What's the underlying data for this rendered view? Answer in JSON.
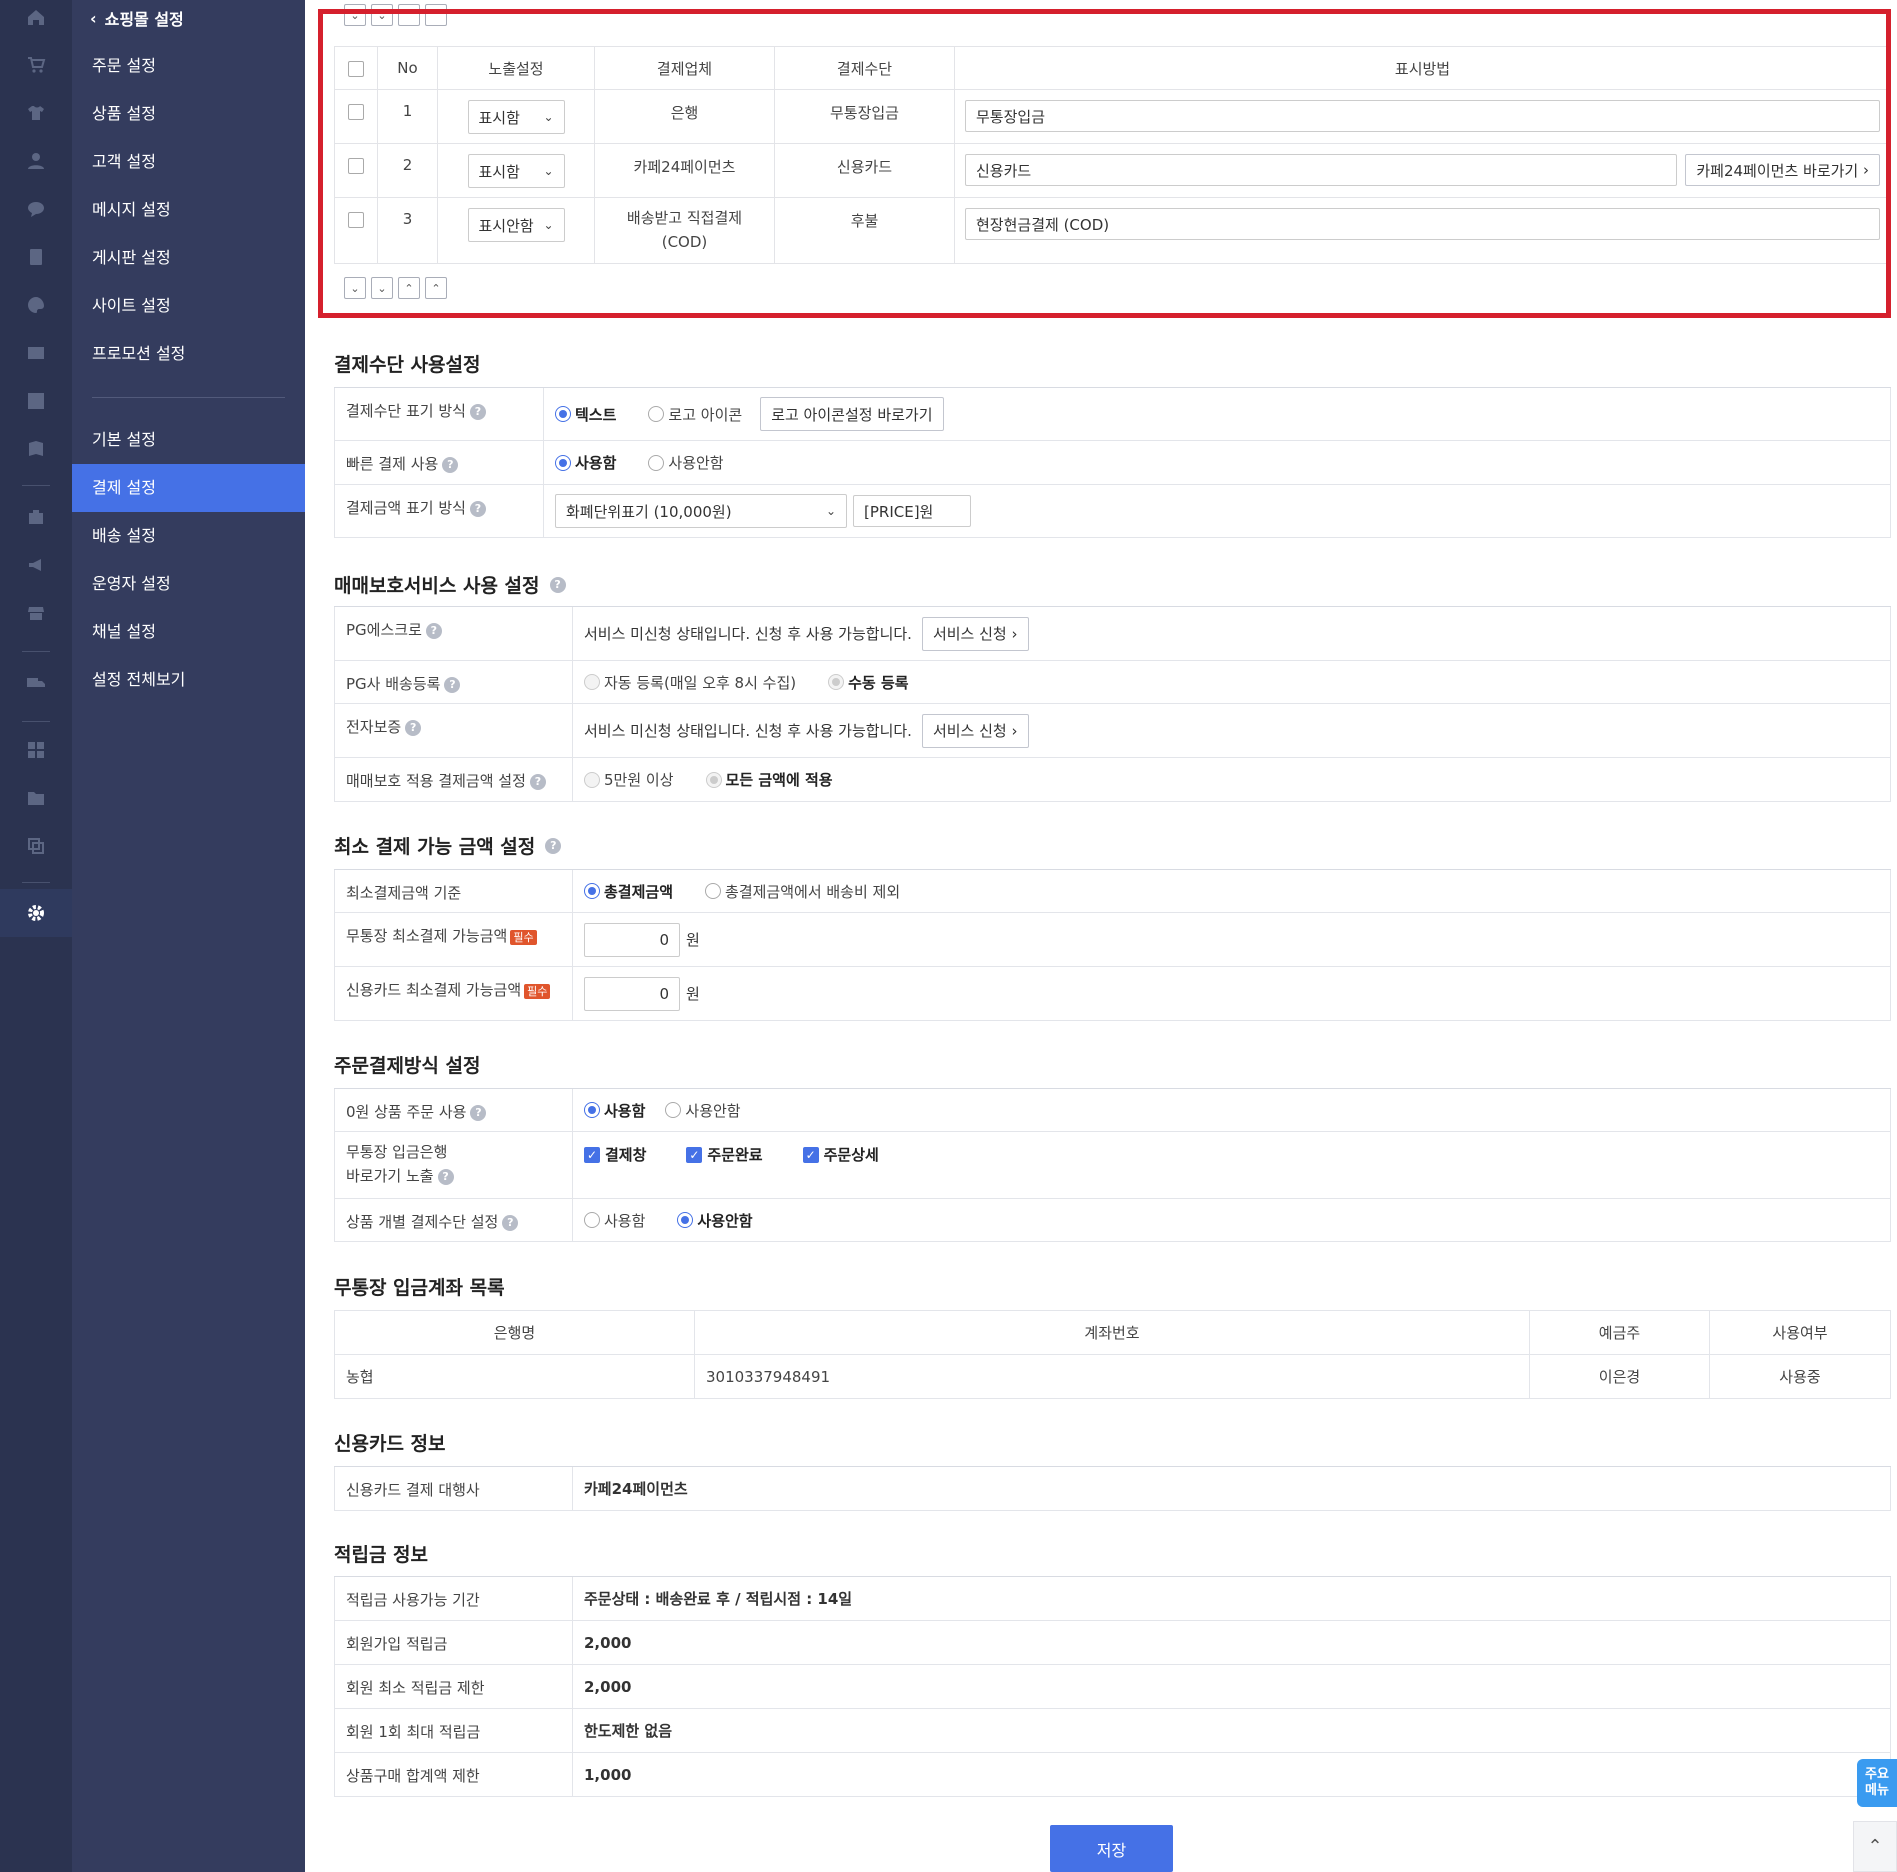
{
  "menu": {
    "back_label": "쇼핑몰 설정",
    "group1": [
      "주문 설정",
      "상품 설정",
      "고객 설정",
      "메시지 설정",
      "게시판 설정",
      "사이트 설정",
      "프로모션 설정"
    ],
    "group2": [
      "기본 설정",
      "결제 설정",
      "배송 설정",
      "운영자 설정",
      "채널 설정",
      "설정 전체보기"
    ],
    "active": "결제 설정"
  },
  "payment_methods": {
    "headers": [
      "No",
      "노출설정",
      "결제업체",
      "결제수단",
      "표시방법"
    ],
    "rows": [
      {
        "no": "1",
        "display": "표시함",
        "provider": "은행",
        "method": "무통장입금",
        "label": "무통장입금"
      },
      {
        "no": "2",
        "display": "표시함",
        "provider": "카페24페이먼츠",
        "method": "신용카드",
        "label": "신용카드",
        "link": "카페24페이먼츠 바로가기"
      },
      {
        "no": "3",
        "display": "표시안함",
        "provider_line1": "배송받고 직접결제",
        "provider_line2": "(COD)",
        "method": "후불",
        "label": "현장현금결제 (COD)"
      }
    ]
  },
  "usage": {
    "title": "결제수단 사용설정",
    "display_mode_label": "결제수단 표기 방식",
    "display_text": "텍스트",
    "display_icon": "로고 아이콘",
    "icon_link": "로고 아이콘설정 바로가기",
    "quick_pay_label": "빠른 결제 사용",
    "use": "사용함",
    "not_use": "사용안함",
    "amount_mode_label": "결제금액 표기 방식",
    "amount_select": "화폐단위표기 (10,000원)",
    "amount_format": "[PRICE]원"
  },
  "escrow": {
    "title": "매매보호서비스 사용 설정",
    "pg_escrow_label": "PG에스크로",
    "status_text": "서비스 미신청 상태입니다. 신청 후 사용 가능합니다.",
    "apply_btn": "서비스 신청 ›",
    "pg_delivery_label": "PG사 배송등록",
    "auto_reg": "자동 등록(매일 오후 8시 수집)",
    "manual_reg": "수동 등록",
    "e_guarantee_label": "전자보증",
    "amount_label": "매매보호 적용 결제금액 설정",
    "over_50k": "5만원 이상",
    "all_amount": "모든 금액에 적용"
  },
  "min_amount": {
    "title": "최소 결제 가능 금액 설정",
    "basis_label": "최소결제금액 기준",
    "total": "총결제금액",
    "total_minus_ship": "총결제금액에서 배송비 제외",
    "bank_label": "무통장 최소결제 가능금액",
    "card_label": "신용카드 최소결제 가능금액",
    "required": "필수",
    "bank_value": "0",
    "card_value": "0",
    "unit": "원"
  },
  "order_pay": {
    "title": "주문결제방식 설정",
    "zero_order_label": "0원 상품 주문 사용",
    "bank_shortcut_label_1": "무통장 입금은행",
    "bank_shortcut_label_2": "바로가기 노출",
    "chk_payment": "결제창",
    "chk_complete": "주문완료",
    "chk_detail": "주문상세",
    "per_product_label": "상품 개별 결제수단 설정"
  },
  "bank_accounts": {
    "title": "무통장 입금계좌 목록",
    "headers": [
      "은행명",
      "계좌번호",
      "예금주",
      "사용여부"
    ],
    "rows": [
      {
        "bank": "농협",
        "account": "3010337948491",
        "holder": "이은경",
        "status": "사용중"
      }
    ]
  },
  "card_info": {
    "title": "신용카드 정보",
    "agent_label": "신용카드 결제 대행사",
    "agent_value": "카페24페이먼츠"
  },
  "points": {
    "title": "적립금 정보",
    "rows": [
      {
        "label": "적립금 사용가능 기간",
        "value": "주문상태 : 배송완료 후 / 적립시점 : 14일"
      },
      {
        "label": "회원가입 적립금",
        "value": "2,000"
      },
      {
        "label": "회원 최소 적립금 제한",
        "value": "2,000"
      },
      {
        "label": "회원 1회 최대 적립금",
        "value": "한도제한 없음"
      },
      {
        "label": "상품구매 합계액 제한",
        "value": "1,000"
      }
    ]
  },
  "save_label": "저장",
  "quick_menu_line1": "주요",
  "quick_menu_line2": "메뉴",
  "help_mark": "?",
  "icons": [
    "home-icon",
    "cart-icon",
    "shirt-icon",
    "user-icon",
    "chat-icon",
    "board-icon",
    "palette-icon",
    "image-icon",
    "chart-icon",
    "book-icon",
    "store-icon",
    "megaphone-icon",
    "shop-icon",
    "truck-icon",
    "apps-icon",
    "folder-plus-icon",
    "copy-icon",
    "gear-icon"
  ],
  "colors": {
    "accent": "#4571e6",
    "sidebar": "#2b3350",
    "menu": "#343c5e",
    "highlight": "#d5202d"
  }
}
